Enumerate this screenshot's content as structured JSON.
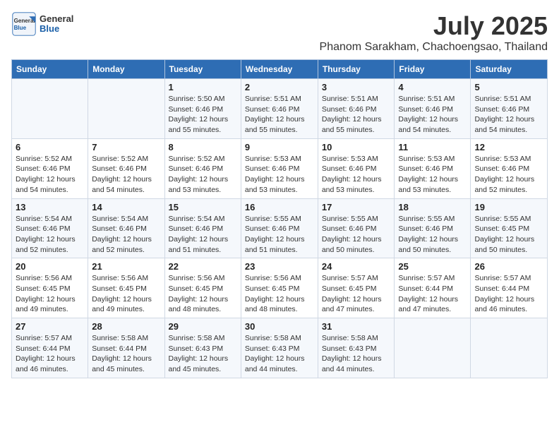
{
  "header": {
    "logo_general": "General",
    "logo_blue": "Blue",
    "month_year": "July 2025",
    "location": "Phanom Sarakham, Chachoengsao, Thailand"
  },
  "weekdays": [
    "Sunday",
    "Monday",
    "Tuesday",
    "Wednesday",
    "Thursday",
    "Friday",
    "Saturday"
  ],
  "weeks": [
    [
      {
        "day": "",
        "sunrise": "",
        "sunset": "",
        "daylight": ""
      },
      {
        "day": "",
        "sunrise": "",
        "sunset": "",
        "daylight": ""
      },
      {
        "day": "1",
        "sunrise": "Sunrise: 5:50 AM",
        "sunset": "Sunset: 6:46 PM",
        "daylight": "Daylight: 12 hours and 55 minutes."
      },
      {
        "day": "2",
        "sunrise": "Sunrise: 5:51 AM",
        "sunset": "Sunset: 6:46 PM",
        "daylight": "Daylight: 12 hours and 55 minutes."
      },
      {
        "day": "3",
        "sunrise": "Sunrise: 5:51 AM",
        "sunset": "Sunset: 6:46 PM",
        "daylight": "Daylight: 12 hours and 55 minutes."
      },
      {
        "day": "4",
        "sunrise": "Sunrise: 5:51 AM",
        "sunset": "Sunset: 6:46 PM",
        "daylight": "Daylight: 12 hours and 54 minutes."
      },
      {
        "day": "5",
        "sunrise": "Sunrise: 5:51 AM",
        "sunset": "Sunset: 6:46 PM",
        "daylight": "Daylight: 12 hours and 54 minutes."
      }
    ],
    [
      {
        "day": "6",
        "sunrise": "Sunrise: 5:52 AM",
        "sunset": "Sunset: 6:46 PM",
        "daylight": "Daylight: 12 hours and 54 minutes."
      },
      {
        "day": "7",
        "sunrise": "Sunrise: 5:52 AM",
        "sunset": "Sunset: 6:46 PM",
        "daylight": "Daylight: 12 hours and 54 minutes."
      },
      {
        "day": "8",
        "sunrise": "Sunrise: 5:52 AM",
        "sunset": "Sunset: 6:46 PM",
        "daylight": "Daylight: 12 hours and 53 minutes."
      },
      {
        "day": "9",
        "sunrise": "Sunrise: 5:53 AM",
        "sunset": "Sunset: 6:46 PM",
        "daylight": "Daylight: 12 hours and 53 minutes."
      },
      {
        "day": "10",
        "sunrise": "Sunrise: 5:53 AM",
        "sunset": "Sunset: 6:46 PM",
        "daylight": "Daylight: 12 hours and 53 minutes."
      },
      {
        "day": "11",
        "sunrise": "Sunrise: 5:53 AM",
        "sunset": "Sunset: 6:46 PM",
        "daylight": "Daylight: 12 hours and 53 minutes."
      },
      {
        "day": "12",
        "sunrise": "Sunrise: 5:53 AM",
        "sunset": "Sunset: 6:46 PM",
        "daylight": "Daylight: 12 hours and 52 minutes."
      }
    ],
    [
      {
        "day": "13",
        "sunrise": "Sunrise: 5:54 AM",
        "sunset": "Sunset: 6:46 PM",
        "daylight": "Daylight: 12 hours and 52 minutes."
      },
      {
        "day": "14",
        "sunrise": "Sunrise: 5:54 AM",
        "sunset": "Sunset: 6:46 PM",
        "daylight": "Daylight: 12 hours and 52 minutes."
      },
      {
        "day": "15",
        "sunrise": "Sunrise: 5:54 AM",
        "sunset": "Sunset: 6:46 PM",
        "daylight": "Daylight: 12 hours and 51 minutes."
      },
      {
        "day": "16",
        "sunrise": "Sunrise: 5:55 AM",
        "sunset": "Sunset: 6:46 PM",
        "daylight": "Daylight: 12 hours and 51 minutes."
      },
      {
        "day": "17",
        "sunrise": "Sunrise: 5:55 AM",
        "sunset": "Sunset: 6:46 PM",
        "daylight": "Daylight: 12 hours and 50 minutes."
      },
      {
        "day": "18",
        "sunrise": "Sunrise: 5:55 AM",
        "sunset": "Sunset: 6:46 PM",
        "daylight": "Daylight: 12 hours and 50 minutes."
      },
      {
        "day": "19",
        "sunrise": "Sunrise: 5:55 AM",
        "sunset": "Sunset: 6:45 PM",
        "daylight": "Daylight: 12 hours and 50 minutes."
      }
    ],
    [
      {
        "day": "20",
        "sunrise": "Sunrise: 5:56 AM",
        "sunset": "Sunset: 6:45 PM",
        "daylight": "Daylight: 12 hours and 49 minutes."
      },
      {
        "day": "21",
        "sunrise": "Sunrise: 5:56 AM",
        "sunset": "Sunset: 6:45 PM",
        "daylight": "Daylight: 12 hours and 49 minutes."
      },
      {
        "day": "22",
        "sunrise": "Sunrise: 5:56 AM",
        "sunset": "Sunset: 6:45 PM",
        "daylight": "Daylight: 12 hours and 48 minutes."
      },
      {
        "day": "23",
        "sunrise": "Sunrise: 5:56 AM",
        "sunset": "Sunset: 6:45 PM",
        "daylight": "Daylight: 12 hours and 48 minutes."
      },
      {
        "day": "24",
        "sunrise": "Sunrise: 5:57 AM",
        "sunset": "Sunset: 6:45 PM",
        "daylight": "Daylight: 12 hours and 47 minutes."
      },
      {
        "day": "25",
        "sunrise": "Sunrise: 5:57 AM",
        "sunset": "Sunset: 6:44 PM",
        "daylight": "Daylight: 12 hours and 47 minutes."
      },
      {
        "day": "26",
        "sunrise": "Sunrise: 5:57 AM",
        "sunset": "Sunset: 6:44 PM",
        "daylight": "Daylight: 12 hours and 46 minutes."
      }
    ],
    [
      {
        "day": "27",
        "sunrise": "Sunrise: 5:57 AM",
        "sunset": "Sunset: 6:44 PM",
        "daylight": "Daylight: 12 hours and 46 minutes."
      },
      {
        "day": "28",
        "sunrise": "Sunrise: 5:58 AM",
        "sunset": "Sunset: 6:44 PM",
        "daylight": "Daylight: 12 hours and 45 minutes."
      },
      {
        "day": "29",
        "sunrise": "Sunrise: 5:58 AM",
        "sunset": "Sunset: 6:43 PM",
        "daylight": "Daylight: 12 hours and 45 minutes."
      },
      {
        "day": "30",
        "sunrise": "Sunrise: 5:58 AM",
        "sunset": "Sunset: 6:43 PM",
        "daylight": "Daylight: 12 hours and 44 minutes."
      },
      {
        "day": "31",
        "sunrise": "Sunrise: 5:58 AM",
        "sunset": "Sunset: 6:43 PM",
        "daylight": "Daylight: 12 hours and 44 minutes."
      },
      {
        "day": "",
        "sunrise": "",
        "sunset": "",
        "daylight": ""
      },
      {
        "day": "",
        "sunrise": "",
        "sunset": "",
        "daylight": ""
      }
    ]
  ]
}
